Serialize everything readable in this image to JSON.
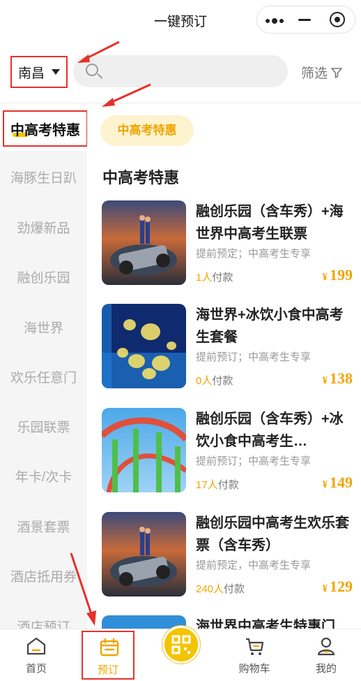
{
  "titlebar": {
    "title": "一键预订"
  },
  "search": {
    "city": "南昌",
    "placeholder": "",
    "filter_label": "筛选"
  },
  "sidebar": {
    "active": "中高考特惠",
    "items": [
      "海豚生日趴",
      "劲爆新品",
      "融创乐园",
      "海世界",
      "欢乐任意门",
      "乐园联票",
      "年卡/次卡",
      "酒景套票",
      "酒店抵用券",
      "酒店预订"
    ]
  },
  "main": {
    "tag": "中高考特惠",
    "section_title": "中高考特惠",
    "cards": [
      {
        "title": "融创乐园（含车秀）+海世界中高考生联票",
        "desc": "提前预定；中高考生专享",
        "people": "1人",
        "people_suffix": "付款",
        "currency": "¥",
        "price": "199",
        "thumb_icon": "car-show-photo"
      },
      {
        "title": "海世界+冰饮小食中高考生套餐",
        "desc": "提前预订；中高考生专享",
        "people": "0人",
        "people_suffix": "付款",
        "currency": "¥",
        "price": "138",
        "thumb_icon": "jellyfish-photo"
      },
      {
        "title": "融创乐园（含车秀）+冰饮小食中高考生…",
        "desc": "提前预订；中高考生专享",
        "people": "17人",
        "people_suffix": "付款",
        "currency": "¥",
        "price": "149",
        "thumb_icon": "rollercoaster-photo"
      },
      {
        "title": "融创乐园中高考生欢乐套票（含车秀）",
        "desc": "提前预定，中高考生专享",
        "people": "240人",
        "people_suffix": "付款",
        "currency": "¥",
        "price": "129",
        "thumb_icon": "car-show-photo"
      },
      {
        "title": "海世界中高考生特惠门",
        "desc": "",
        "people": "",
        "people_suffix": "",
        "currency": "",
        "price": "",
        "thumb_icon": "ocean-photo"
      }
    ]
  },
  "tabbar": {
    "items": [
      {
        "label": "首页",
        "icon": "home-icon"
      },
      {
        "label": "预订",
        "icon": "calendar-icon"
      },
      {
        "label": "",
        "icon": "qr-scan-icon"
      },
      {
        "label": "购物车",
        "icon": "cart-icon"
      },
      {
        "label": "我的",
        "icon": "user-icon"
      }
    ]
  },
  "colors": {
    "accent": "#f0a500",
    "annotation": "#e5322b",
    "tag_bg": "#fdf3cf"
  }
}
